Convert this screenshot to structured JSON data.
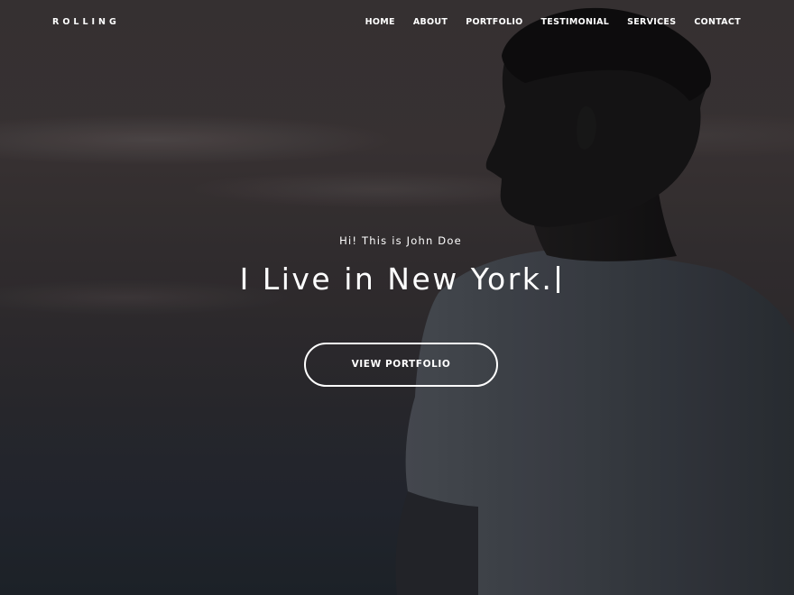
{
  "brand": {
    "logo_text": "ROLLING"
  },
  "nav": {
    "items": [
      {
        "label": "HOME"
      },
      {
        "label": "ABOUT"
      },
      {
        "label": "PORTFOLIO"
      },
      {
        "label": "TESTIMONIAL"
      },
      {
        "label": "SERVICES"
      },
      {
        "label": "CONTACT"
      }
    ]
  },
  "hero": {
    "greeting": "Hi! This is John Doe",
    "headline": "I Live in New York.",
    "cta_label": "VIEW PORTFOLIO",
    "background_image": "man-silhouette-against-dusky-sky"
  },
  "colors": {
    "text": "#ffffff",
    "background_dark": "#26272b",
    "sky_top": "#3c3637",
    "sky_bottom": "#1f242b"
  }
}
